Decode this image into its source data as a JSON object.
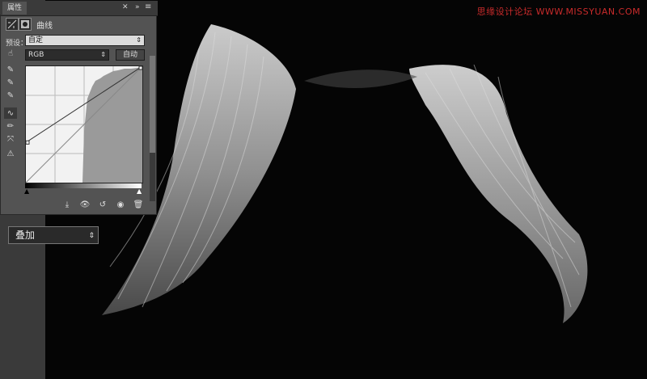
{
  "watermark": "思缘设计论坛 WWW.MISSYUAN.COM",
  "panel": {
    "tab_label": "属性",
    "title": "曲线",
    "preset_label": "预设：",
    "preset_value": "自定",
    "channel_value": "RGB",
    "auto_label": "自动"
  },
  "blend_mode": "叠加",
  "curve": {
    "points": [
      [
        0,
        0
      ],
      [
        255,
        255
      ]
    ],
    "adjusted": [
      [
        0,
        88
      ],
      [
        255,
        255
      ]
    ]
  },
  "colors": {
    "panel_bg": "#535353",
    "graph_bg": "#f2f2f2",
    "histogram": "#9a9a9a",
    "canvas_bg": "#050505"
  }
}
